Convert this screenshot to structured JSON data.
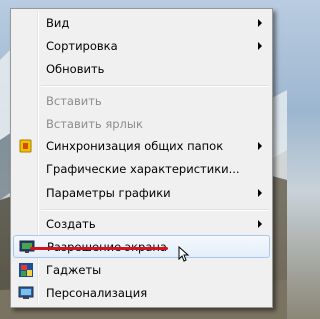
{
  "menu": {
    "items": [
      {
        "label": "Вид"
      },
      {
        "label": "Сортировка"
      },
      {
        "label": "Обновить"
      },
      {
        "label": "Вставить"
      },
      {
        "label": "Вставить ярлык"
      },
      {
        "label": "Синхронизация общих папок"
      },
      {
        "label": "Графические характеристики..."
      },
      {
        "label": "Параметры графики"
      },
      {
        "label": "Создать"
      },
      {
        "label": "Разрешение экрана"
      },
      {
        "label": "Гаджеты"
      },
      {
        "label": "Персонализация"
      }
    ]
  },
  "colors": {
    "menu_bg": "#f0f0f0",
    "hover_border": "#a8c8ec",
    "disabled_text": "#8d8d8d",
    "annotation_underline": "#d0161a"
  },
  "icons": [
    "sync-folder-icon",
    "display-resolution-icon",
    "gadgets-icon",
    "personalization-icon",
    "mouse-pointer-icon"
  ]
}
